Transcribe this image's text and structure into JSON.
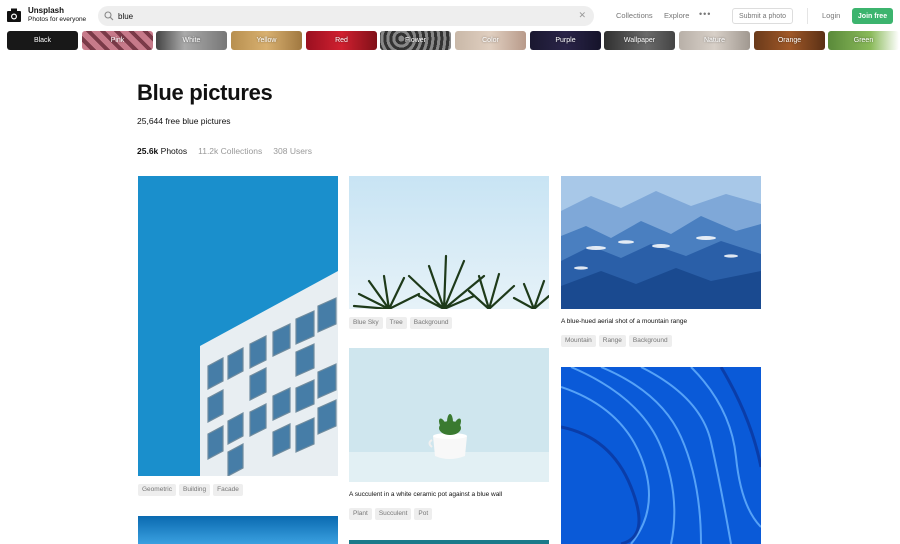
{
  "header": {
    "brand": "Unsplash",
    "tagline": "Photos for everyone",
    "search_value": "blue",
    "nav": {
      "collections": "Collections",
      "explore": "Explore",
      "more": "•••",
      "submit": "Submit a photo",
      "login": "Login",
      "join": "Join free"
    },
    "join_color": "#3cb46e"
  },
  "related": [
    "Black",
    "Pink",
    "White",
    "Yellow",
    "Red",
    "Flower",
    "Color",
    "Purple",
    "Wallpaper",
    "Nature",
    "Orange",
    "Green"
  ],
  "page": {
    "title": "Blue pictures",
    "subtitle": "25,644 free blue pictures",
    "tabs": [
      {
        "count": "25.6k",
        "label": "Photos"
      },
      {
        "count": "11.2k",
        "label": "Collections"
      },
      {
        "count": "308",
        "label": "Users"
      }
    ]
  },
  "photos": {
    "building": {
      "tags": [
        "Geometric",
        "Building",
        "Facade"
      ]
    },
    "palms": {
      "tags": [
        "Blue Sky",
        "Tree",
        "Background"
      ]
    },
    "succulent": {
      "caption": "A succulent in a white ceramic pot against a blue wall",
      "tags": [
        "Plant",
        "Succulent",
        "Pot"
      ]
    },
    "mountains": {
      "caption": "A blue-hued aerial shot of a mountain range",
      "tags": [
        "Mountain",
        "Range",
        "Background"
      ]
    }
  }
}
